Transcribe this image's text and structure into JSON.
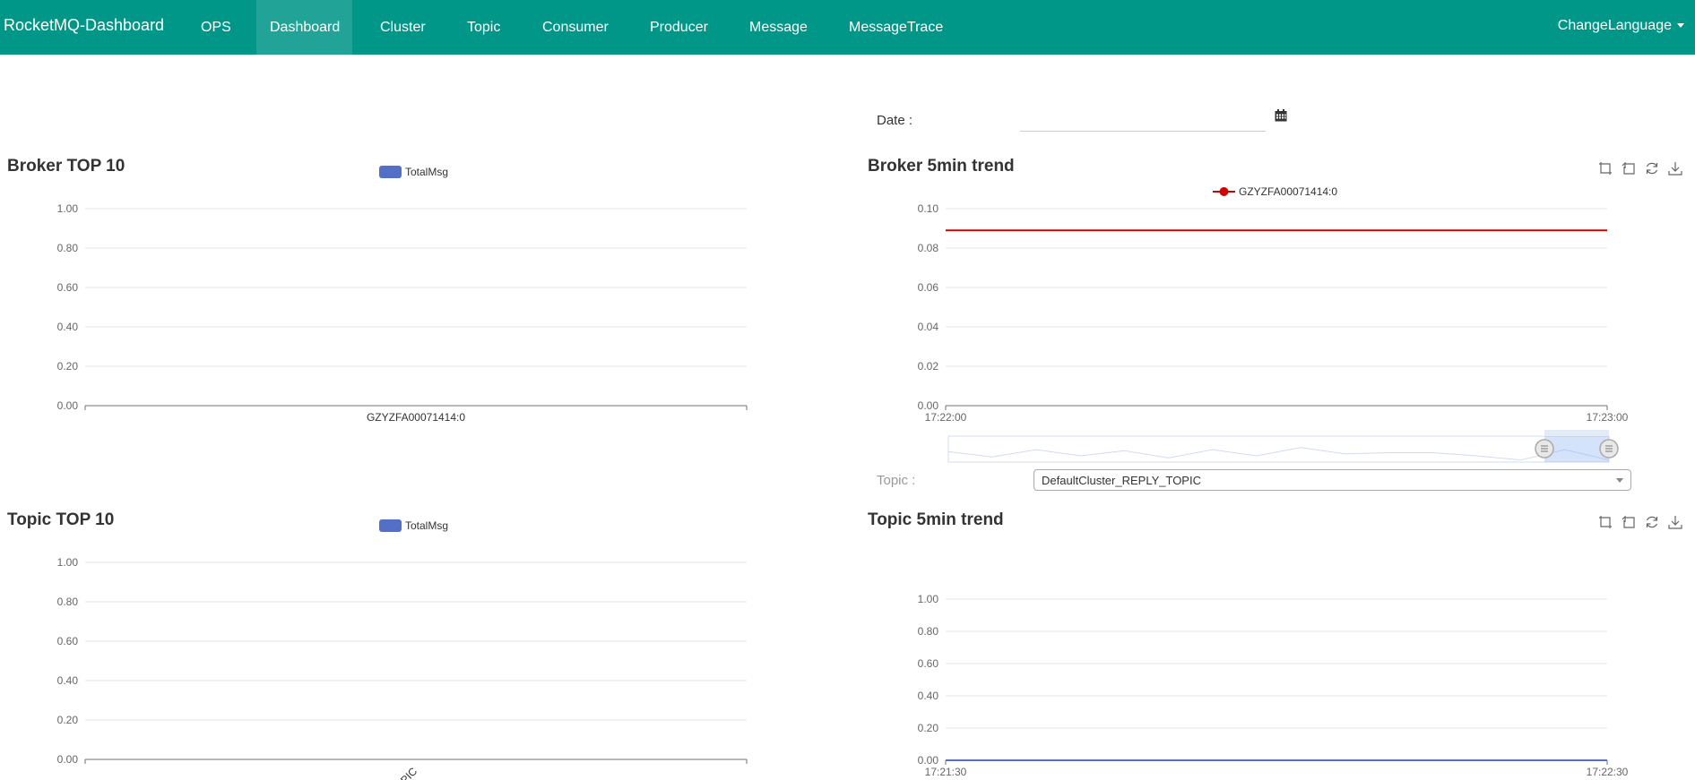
{
  "navbar": {
    "brand": "RocketMQ-Dashboard",
    "items": [
      {
        "label": "OPS",
        "name": "nav-ops"
      },
      {
        "label": "Dashboard",
        "name": "nav-dashboard",
        "active": true
      },
      {
        "label": "Cluster",
        "name": "nav-cluster"
      },
      {
        "label": "Topic",
        "name": "nav-topic"
      },
      {
        "label": "Consumer",
        "name": "nav-consumer"
      },
      {
        "label": "Producer",
        "name": "nav-producer"
      },
      {
        "label": "Message",
        "name": "nav-message"
      },
      {
        "label": "MessageTrace",
        "name": "nav-messagetrace"
      }
    ],
    "language": "ChangeLanguage"
  },
  "filters": {
    "date_label": "Date :",
    "date_value": "",
    "topic_label": "Topic :",
    "topic_value": "DefaultCluster_REPLY_TOPIC"
  },
  "colors": {
    "navbar": "#009688",
    "bar_series": "#5470c6",
    "broker_trend_line": "#d00000",
    "topic_trend_line": "#5470c6"
  },
  "icons": [
    "calendar-icon",
    "zoom-icon",
    "zoom-reset-icon",
    "refresh-icon",
    "download-icon"
  ],
  "chart_data": [
    {
      "id": "broker-top10",
      "type": "bar",
      "title": "Broker TOP 10",
      "legend": [
        "TotalMsg"
      ],
      "categories": [
        "GZYZFA00071414:0"
      ],
      "series": [
        {
          "name": "TotalMsg",
          "values": [
            0
          ]
        }
      ],
      "yticks": [
        "0.00",
        "0.20",
        "0.40",
        "0.60",
        "0.80",
        "1.00"
      ],
      "ylim": [
        0,
        1
      ]
    },
    {
      "id": "broker-5min-trend",
      "type": "line",
      "title": "Broker 5min trend",
      "legend": [
        "GZYZFA00071414:0"
      ],
      "xticks": [
        "17:22:00",
        "17:23:00"
      ],
      "yticks": [
        "0.00",
        "0.02",
        "0.04",
        "0.06",
        "0.08",
        "0.10"
      ],
      "ylim": [
        0,
        0.1
      ],
      "series": [
        {
          "name": "GZYZFA00071414:0",
          "values": [
            0.089,
            0.089
          ]
        }
      ],
      "data_zoom": true
    },
    {
      "id": "topic-top10",
      "type": "bar",
      "title": "Topic TOP 10",
      "legend": [
        "TotalMsg"
      ],
      "categories": [
        "PIC"
      ],
      "series": [
        {
          "name": "TotalMsg",
          "values": [
            0
          ]
        }
      ],
      "yticks": [
        "0.00",
        "0.20",
        "0.40",
        "0.60",
        "0.80",
        "1.00"
      ],
      "ylim": [
        0,
        1
      ]
    },
    {
      "id": "topic-5min-trend",
      "type": "line",
      "title": "Topic 5min trend",
      "xticks": [
        "17:21:30",
        "17:22:30"
      ],
      "yticks": [
        "0.00",
        "0.20",
        "0.40",
        "0.60",
        "0.80",
        "1.00"
      ],
      "ylim": [
        0,
        1
      ],
      "series": [
        {
          "values": [
            0,
            0
          ]
        }
      ]
    }
  ]
}
